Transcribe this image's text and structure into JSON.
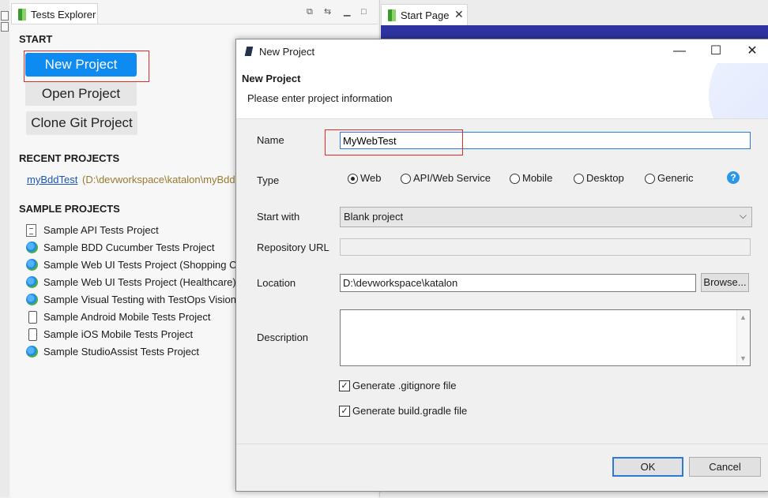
{
  "explorer": {
    "tab_label": "Tests Explorer",
    "start_heading": "START",
    "new_project": "New Project",
    "open_project": "Open Project",
    "clone_git": "Clone Git Project",
    "recent_heading": "RECENT PROJECTS",
    "recent_link": "myBddTest",
    "recent_path": "(D:\\devworkspace\\katalon\\myBddTest)",
    "sample_heading": "SAMPLE PROJECTS",
    "samples": [
      {
        "label": "Sample API Tests Project",
        "icon": "api-doc-icon"
      },
      {
        "label": "Sample BDD Cucumber Tests Project",
        "icon": "globe-icon"
      },
      {
        "label": "Sample Web UI Tests Project (Shopping Cart)",
        "icon": "globe-icon"
      },
      {
        "label": "Sample Web UI Tests Project (Healthcare)",
        "icon": "globe-icon"
      },
      {
        "label": "Sample Visual Testing with TestOps Vision",
        "icon": "globe-icon"
      },
      {
        "label": "Sample Android Mobile Tests Project",
        "icon": "phone-icon"
      },
      {
        "label": "Sample iOS Mobile Tests Project",
        "icon": "phone-icon"
      },
      {
        "label": "Sample StudioAssist Tests Project",
        "icon": "globe-icon"
      }
    ]
  },
  "start_page": {
    "tab_label": "Start Page"
  },
  "dialog": {
    "window_title": "New Project",
    "header_title": "New Project",
    "header_subtitle": "Please enter project information",
    "name_label": "Name",
    "name_value": "MyWebTest",
    "type_label": "Type",
    "types": [
      "Web",
      "API/Web Service",
      "Mobile",
      "Desktop",
      "Generic"
    ],
    "selected_type": "Web",
    "start_with_label": "Start with",
    "start_with_value": "Blank project",
    "repo_label": "Repository URL",
    "repo_value": "",
    "location_label": "Location",
    "location_value": "D:\\devworkspace\\katalon",
    "browse_label": "Browse...",
    "description_label": "Description",
    "description_value": "",
    "gitignore_label": "Generate .gitignore file",
    "gitignore_checked": true,
    "gradle_label": "Generate build.gradle file",
    "gradle_checked": true,
    "ok_label": "OK",
    "cancel_label": "Cancel"
  },
  "colors": {
    "primary_button": "#0d8bf0",
    "highlight_box": "#e02b2b",
    "focus": "#2d7ad6"
  }
}
